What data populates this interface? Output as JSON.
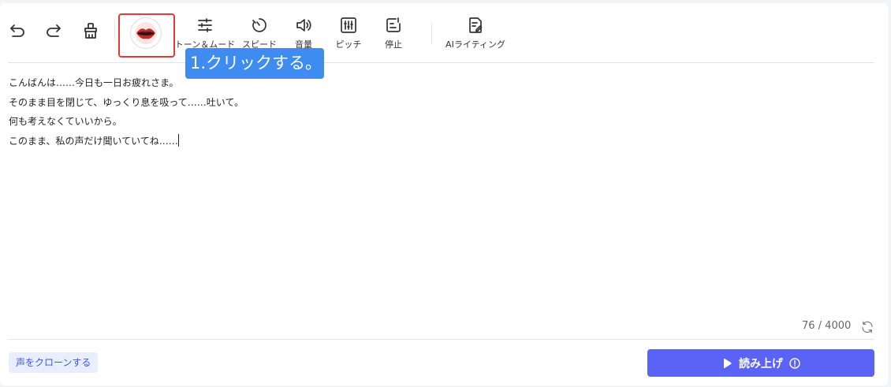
{
  "toolbar": {
    "tools": [
      {
        "id": "tone",
        "label": "トーン＆ムード",
        "icon": "sliders-icon"
      },
      {
        "id": "speed",
        "label": "スピード",
        "icon": "speedometer-icon"
      },
      {
        "id": "volume",
        "label": "音量",
        "icon": "speaker-icon"
      },
      {
        "id": "pitch",
        "label": "ピッチ",
        "icon": "equalizer-icon"
      },
      {
        "id": "pause",
        "label": "停止",
        "icon": "pause-insert-icon"
      },
      {
        "id": "ai",
        "label": "AIライティング",
        "icon": "ai-writing-icon"
      }
    ],
    "voice_avatar": "lips-avatar"
  },
  "callout": {
    "text": "1.クリックする。"
  },
  "editor": {
    "lines": [
      "こんばんは……今日も一日お疲れさま。",
      "そのまま目を閉じて、ゆっくり息を吸って……吐いて。",
      "何も考えなくていいから。",
      "このまま、私の声だけ聞いていてね……"
    ]
  },
  "counter": {
    "text": "76 / 4000"
  },
  "footer": {
    "clone_label": "声をクローンする",
    "read_label": "読み上げ"
  },
  "colors": {
    "accent": "#5b63f6",
    "callout": "#3f8cf0",
    "highlight_border": "#e53935",
    "clone_bg": "#e8eefc",
    "clone_text": "#3b55e6"
  }
}
